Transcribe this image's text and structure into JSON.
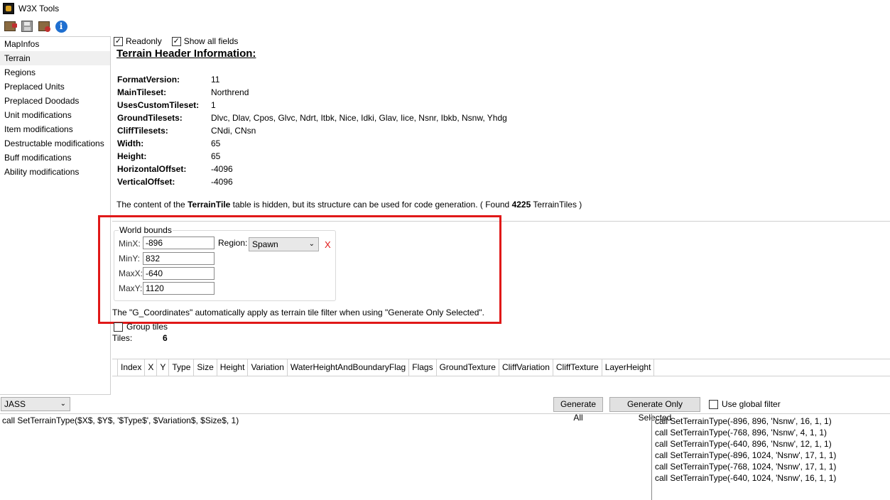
{
  "app": {
    "title": "W3X Tools"
  },
  "toolbar": {
    "buttons": [
      {
        "icon": "open-map-icon"
      },
      {
        "icon": "save-icon"
      },
      {
        "icon": "save-as-icon"
      },
      {
        "icon": "info-icon",
        "glyph": "i"
      }
    ]
  },
  "sidebar": {
    "items": [
      {
        "label": "MapInfos"
      },
      {
        "label": "Terrain",
        "selected": true
      },
      {
        "label": "Regions"
      },
      {
        "label": "Preplaced Units"
      },
      {
        "label": "Preplaced Doodads"
      },
      {
        "label": "Unit modifications"
      },
      {
        "label": "Item modifications"
      },
      {
        "label": "Destructable modifications"
      },
      {
        "label": "Buff modifications"
      },
      {
        "label": "Ability modifications"
      }
    ]
  },
  "options": {
    "readonly_label": "Readonly",
    "readonly_checked": true,
    "show_all_label": "Show all fields",
    "show_all_checked": true
  },
  "terrain": {
    "title": "Terrain Header Information:",
    "fields": [
      {
        "key": "FormatVersion:",
        "value": "11"
      },
      {
        "key": "MainTileset:",
        "value": "Northrend"
      },
      {
        "key": "UsesCustomTileset:",
        "value": "1"
      },
      {
        "key": "GroundTilesets:",
        "value": "Dlvc, Dlav, Cpos, Glvc, Ndrt, Itbk, Nice, Idki, Glav, Iice, Nsnr, Ibkb, Nsnw, Yhdg"
      },
      {
        "key": "CliffTilesets:",
        "value": "CNdi, CNsn"
      },
      {
        "key": "Width:",
        "value": "65"
      },
      {
        "key": "Height:",
        "value": "65"
      },
      {
        "key": "HorizontalOffset:",
        "value": "-4096"
      },
      {
        "key": "VerticalOffset:",
        "value": "-4096"
      }
    ],
    "hidden_note": {
      "prefix": "The content of the ",
      "table": "TerrainTile",
      "middle": " table is hidden, but its structure can be used for code generation. ( Found ",
      "count": "4225",
      "suffix": " TerrainTiles )"
    }
  },
  "world_bounds": {
    "legend": "World bounds",
    "minx_label": "MinX:",
    "minx": "-896",
    "miny_label": "MinY:",
    "miny": "832",
    "maxx_label": "MaxX:",
    "maxx": "-640",
    "maxy_label": "MaxY:",
    "maxy": "1120",
    "region_label": "Region:",
    "region_value": "Spawn",
    "clear_label": "X",
    "note": "The \"G_Coordinates\" automatically apply as terrain tile filter when using \"Generate Only Selected\"."
  },
  "tiles": {
    "group_label": "Group tiles",
    "group_checked": false,
    "count_label": "Tiles:",
    "count": "6"
  },
  "grid": {
    "columns": [
      "Index",
      "X",
      "Y",
      "Type",
      "Size",
      "Height",
      "Variation",
      "WaterHeightAndBoundaryFlag",
      "Flags",
      "GroundTexture",
      "CliffVariation",
      "CliffTexture",
      "LayerHeight"
    ]
  },
  "generator": {
    "language": "JASS",
    "generate_all": "Generate All",
    "generate_selected": "Generate Only Selected",
    "global_filter_label": "Use global filter",
    "global_filter_checked": false,
    "template": "call SetTerrainType($X$, $Y$, '$Type$', $Variation$, $Size$, 1)",
    "output": [
      "call SetTerrainType(-896, 896, 'Nsnw', 16, 1, 1)",
      "call SetTerrainType(-768, 896, 'Nsnw', 4, 1, 1)",
      "call SetTerrainType(-640, 896, 'Nsnw', 12, 1, 1)",
      "call SetTerrainType(-896, 1024, 'Nsnw', 17, 1, 1)",
      "call SetTerrainType(-768, 1024, 'Nsnw', 17, 1, 1)",
      "call SetTerrainType(-640, 1024, 'Nsnw', 16, 1, 1)"
    ]
  },
  "colors": {
    "highlight_border": "#e01818",
    "clear_x": "#e01818"
  }
}
